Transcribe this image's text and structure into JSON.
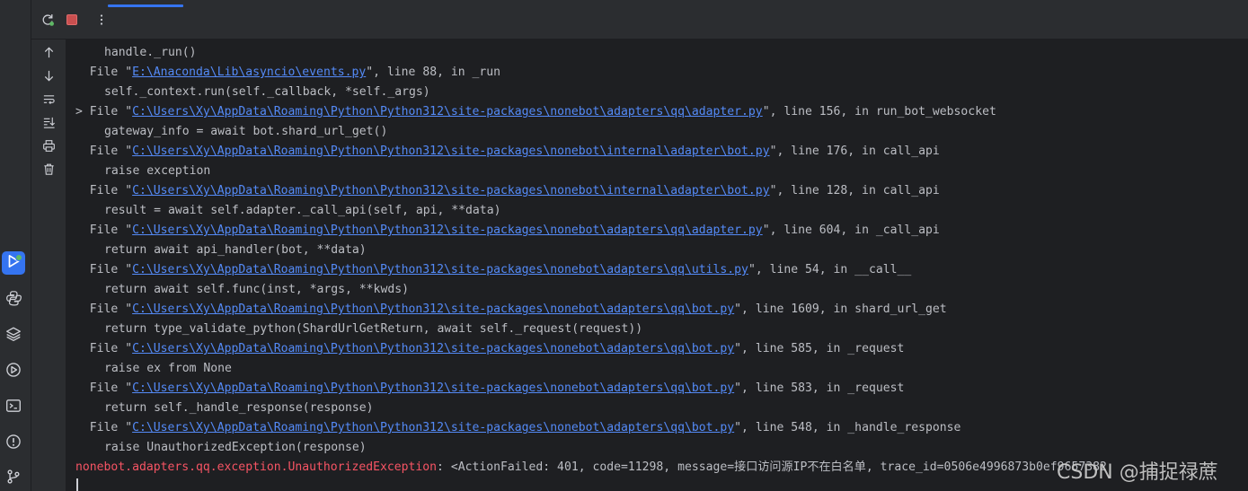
{
  "colors": {
    "background": "#1e1f22",
    "panel": "#2b2d30",
    "text": "#bcbec4",
    "link": "#548af7",
    "error": "#f75464",
    "accent": "#3574f0",
    "stop": "#c94f4f",
    "rerun_green": "#5fb865"
  },
  "activity_bar": {
    "icons": [
      "run-icon",
      "python-console-icon",
      "layers-icon",
      "services-icon",
      "terminal-icon",
      "problems-icon",
      "git-icon"
    ]
  },
  "toolbar": {
    "icons": [
      "rerun-icon",
      "stop-icon",
      "more-vertical-icon"
    ]
  },
  "gutter": {
    "icons": [
      "scroll-up-icon",
      "scroll-down-icon",
      "soft-wrap-icon",
      "scroll-to-end-icon",
      "print-icon",
      "clear-trash-icon"
    ]
  },
  "console": {
    "lines": [
      {
        "kind": "code",
        "text": "handle._run()"
      },
      {
        "kind": "file",
        "fold": false,
        "path": "E:\\Anaconda\\Lib\\asyncio\\events.py",
        "suffix": "\", line 88, in _run"
      },
      {
        "kind": "code",
        "text": "self._context.run(self._callback, *self._args)"
      },
      {
        "kind": "file",
        "fold": true,
        "path": "C:\\Users\\Xy\\AppData\\Roaming\\Python\\Python312\\site-packages\\nonebot\\adapters\\qq\\adapter.py",
        "suffix": "\", line 156, in run_bot_websocket"
      },
      {
        "kind": "code",
        "text": "gateway_info = await bot.shard_url_get()"
      },
      {
        "kind": "file",
        "fold": false,
        "path": "C:\\Users\\Xy\\AppData\\Roaming\\Python\\Python312\\site-packages\\nonebot\\internal\\adapter\\bot.py",
        "suffix": "\", line 176, in call_api"
      },
      {
        "kind": "code",
        "text": "raise exception"
      },
      {
        "kind": "file",
        "fold": false,
        "path": "C:\\Users\\Xy\\AppData\\Roaming\\Python\\Python312\\site-packages\\nonebot\\internal\\adapter\\bot.py",
        "suffix": "\", line 128, in call_api"
      },
      {
        "kind": "code",
        "text": "result = await self.adapter._call_api(self, api, **data)"
      },
      {
        "kind": "file",
        "fold": false,
        "path": "C:\\Users\\Xy\\AppData\\Roaming\\Python\\Python312\\site-packages\\nonebot\\adapters\\qq\\adapter.py",
        "suffix": "\", line 604, in _call_api"
      },
      {
        "kind": "code",
        "text": "return await api_handler(bot, **data)"
      },
      {
        "kind": "file",
        "fold": false,
        "path": "C:\\Users\\Xy\\AppData\\Roaming\\Python\\Python312\\site-packages\\nonebot\\adapters\\qq\\utils.py",
        "suffix": "\", line 54, in __call__"
      },
      {
        "kind": "code",
        "text": "return await self.func(inst, *args, **kwds)"
      },
      {
        "kind": "file",
        "fold": false,
        "path": "C:\\Users\\Xy\\AppData\\Roaming\\Python\\Python312\\site-packages\\nonebot\\adapters\\qq\\bot.py",
        "suffix": "\", line 1609, in shard_url_get"
      },
      {
        "kind": "code",
        "text": "return type_validate_python(ShardUrlGetReturn, await self._request(request))"
      },
      {
        "kind": "file",
        "fold": false,
        "path": "C:\\Users\\Xy\\AppData\\Roaming\\Python\\Python312\\site-packages\\nonebot\\adapters\\qq\\bot.py",
        "suffix": "\", line 585, in _request"
      },
      {
        "kind": "code",
        "text": "raise ex from None"
      },
      {
        "kind": "file",
        "fold": false,
        "path": "C:\\Users\\Xy\\AppData\\Roaming\\Python\\Python312\\site-packages\\nonebot\\adapters\\qq\\bot.py",
        "suffix": "\", line 583, in _request"
      },
      {
        "kind": "code",
        "text": "return self._handle_response(response)"
      },
      {
        "kind": "file",
        "fold": false,
        "path": "C:\\Users\\Xy\\AppData\\Roaming\\Python\\Python312\\site-packages\\nonebot\\adapters\\qq\\bot.py",
        "suffix": "\", line 548, in _handle_response"
      },
      {
        "kind": "code",
        "text": "raise UnauthorizedException(response)"
      }
    ],
    "file_prefix": "File \"",
    "fold_marker": "> ",
    "error_line": {
      "name": "nonebot.adapters.qq.exception.UnauthorizedException",
      "message": ": <ActionFailed: 401, code=11298, message=接口访问源IP不在白名单, trace_id=0506e4996873b0ef9657382"
    }
  },
  "watermark": "CSDN @捕捉禄蔗"
}
